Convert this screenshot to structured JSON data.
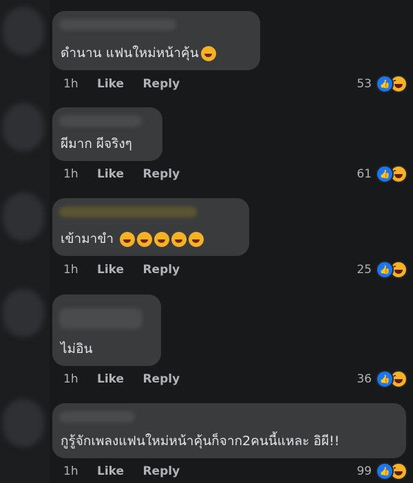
{
  "meta_labels": {
    "like": "Like",
    "reply": "Reply"
  },
  "comments": [
    {
      "text": "ดำนาน แฟนใหม่หน้าคุ้น",
      "time": "1h",
      "count": "53",
      "emoji": [
        "laughing-emoji"
      ]
    },
    {
      "text": "ผีมาก ผีจริงๆ",
      "time": "1h",
      "count": "61",
      "emoji": []
    },
    {
      "text": "เข้ามาขำ",
      "time": "1h",
      "count": "25",
      "emoji": [
        "rofl-emoji",
        "rofl-emoji",
        "rofl-emoji",
        "rofl-emoji",
        "rofl-emoji"
      ]
    },
    {
      "text": "ไม่อิน",
      "time": "1h",
      "count": "36",
      "emoji": []
    },
    {
      "text": "กูรู้จักเพลงแฟนใหม่หน้าคุ้นก็จาก2คนนี้แหละ อิผี!!",
      "time": "1h",
      "count": "99",
      "emoji": []
    }
  ],
  "reaction_icons": [
    "like-icon",
    "haha-icon"
  ]
}
